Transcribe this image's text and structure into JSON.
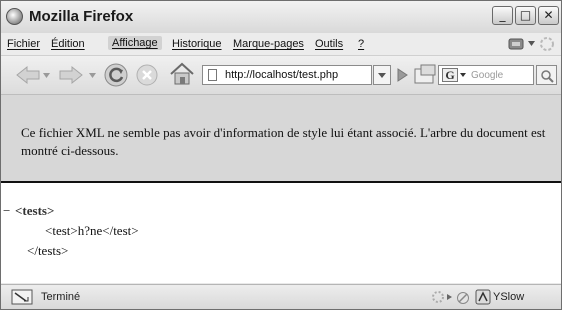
{
  "window": {
    "title": "Mozilla Firefox",
    "controls": {
      "minimize": "_",
      "maximize": "□",
      "close": "✕"
    }
  },
  "menu": [
    {
      "label": "Fichier",
      "active": false
    },
    {
      "label": "Édition",
      "active": false
    },
    {
      "label": "Affichage",
      "active": true
    },
    {
      "label": "Historique",
      "active": false
    },
    {
      "label": "Marque-pages",
      "active": false
    },
    {
      "label": "Outils",
      "active": false
    },
    {
      "label": "?",
      "active": false
    }
  ],
  "toolbar": {
    "url": "http://localhost/test.php",
    "search_engine_letter": "G",
    "search_placeholder": "Google"
  },
  "content": {
    "info_message": "Ce fichier XML ne semble pas avoir d'information de style lui étant associé. L'arbre du document est montré ci-dessous.",
    "xml_tree": {
      "collapse_marker": "−",
      "root_open": "<tests>",
      "child": "<test>h?ne</test>",
      "root_close": "</tests>"
    }
  },
  "status": {
    "text": "Terminé",
    "addon_label": "YSlow"
  }
}
